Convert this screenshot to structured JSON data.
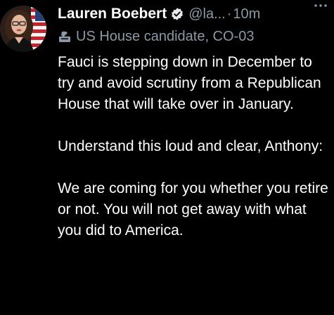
{
  "tweet": {
    "author_name": "Lauren Boebert",
    "handle": "@la...",
    "dot": "·",
    "timestamp": "10m",
    "more_icon": "more-horizontal-icon",
    "verified_icon": "verified-badge-icon",
    "label_icon": "ballot-box-icon",
    "label": "US House candidate, CO-03",
    "paragraphs": [
      "Fauci is stepping down in December to try and avoid scrutiny from a Republican House that will take over in January.",
      "Understand this loud and clear, Anthony:",
      "We are coming for you whether you retire or not. You will not get away with what you did to America."
    ]
  },
  "colors": {
    "background": "#000000",
    "text": "#ffffff",
    "secondary": "#8b98a5"
  }
}
